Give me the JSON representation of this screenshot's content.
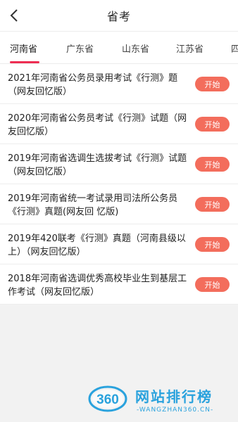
{
  "header": {
    "title": "省考",
    "back_icon": "chevron-left-icon"
  },
  "tabs": [
    {
      "label": "河南省",
      "active": true
    },
    {
      "label": "广东省",
      "active": false
    },
    {
      "label": "山东省",
      "active": false
    },
    {
      "label": "江苏省",
      "active": false
    },
    {
      "label": "四",
      "active": false
    }
  ],
  "accent_color": "#ee2d52",
  "button_color": "#f36d5c",
  "exams": [
    {
      "title": "2021年河南省公务员录用考试《行测》题（网友回忆版）",
      "button": "开始"
    },
    {
      "title": "2020年河南省公务员考试《行测》试题（网友回忆版）",
      "button": "开始"
    },
    {
      "title": "2019年河南省选调生选拔考试《行测》试题（网友回忆版）",
      "button": "开始"
    },
    {
      "title": "2019年河南省统一考试录用司法所公务员《行测》真题(网友回 忆版)",
      "button": "开始"
    },
    {
      "title": "2019年420联考《行测》真题（河南县级以上）（网友回忆版）",
      "button": "开始"
    },
    {
      "title": "2018年河南省选调优秀高校毕业生到基层工作考试（网友回忆版）",
      "button": "开始"
    }
  ],
  "watermark": {
    "logo_text": "360",
    "main": "网站排行榜",
    "sub": "-WANGZHAN360.CN-"
  }
}
